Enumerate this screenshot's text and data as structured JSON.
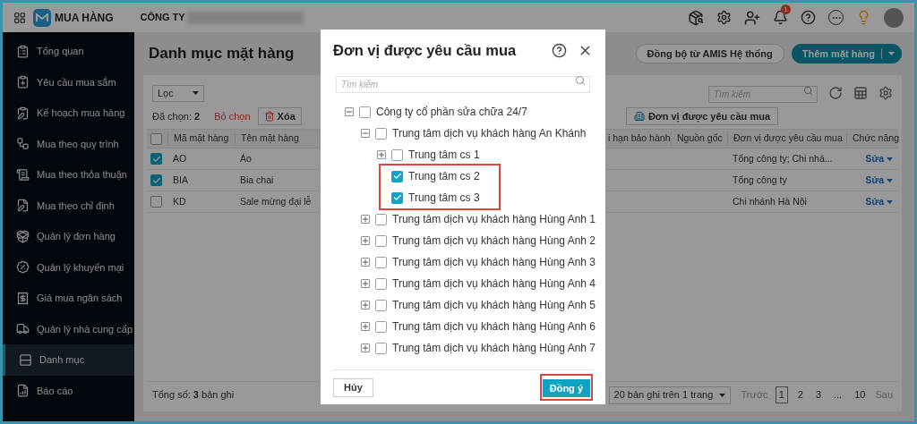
{
  "topbar": {
    "app_name": "MUA HÀNG",
    "company": "CÔNG TY",
    "notification_count": "1"
  },
  "sidebar": {
    "items": [
      {
        "label": "Tổng quan",
        "selected": false
      },
      {
        "label": "Yêu cầu mua sắm",
        "selected": false
      },
      {
        "label": "Kế hoạch mua hàng",
        "selected": false
      },
      {
        "label": "Mua theo quy trình",
        "selected": false
      },
      {
        "label": "Mua theo thỏa thuận",
        "selected": false
      },
      {
        "label": "Mua theo chỉ định",
        "selected": false
      },
      {
        "label": "Quản lý đơn hàng",
        "selected": false
      },
      {
        "label": "Quản lý khuyến mại",
        "selected": false
      },
      {
        "label": "Giá mua ngân sách",
        "selected": false
      },
      {
        "label": "Quản lý nhà cung cấp",
        "selected": false
      },
      {
        "label": "Danh mục",
        "selected": true
      },
      {
        "label": "Báo cáo",
        "selected": false
      }
    ]
  },
  "page": {
    "title": "Danh mục mặt hàng",
    "sync_button": "Đồng bộ từ AMIS Hệ thống",
    "add_button": "Thêm mặt hàng",
    "filter": "Lọc",
    "selected_count": "Đã chọn: **2**",
    "deselect": "Bỏ chọn",
    "delete_button": "Xóa",
    "unit_button": "Đơn vị được yêu cầu mua",
    "search_placeholder": "Tìm kiếm"
  },
  "table": {
    "all_checked": false,
    "columns": [
      "Mã mặt hàng",
      "Tên mặt hàng",
      "i hạn bảo hành",
      "Nguồn gốc",
      "Đơn vị được yêu cầu mua",
      "Chức năng"
    ],
    "rows": [
      {
        "checked": true,
        "code": "AO",
        "name": "Áo",
        "unit": "Tổng công ty; Chi nhá...",
        "action": "Sửa"
      },
      {
        "checked": true,
        "code": "BIA",
        "name": "Bia chai",
        "unit": "Tổng công ty",
        "action": "Sửa"
      },
      {
        "checked": false,
        "code": "KD",
        "name": "Sale mừng đại lễ",
        "unit": "Chi nhánh Hà Nội",
        "action": "Sửa"
      }
    ]
  },
  "footer": {
    "total": "Tổng số: **3** bản ghi",
    "page_size": "20 bản ghi trên 1 trang",
    "prev": "Trước",
    "pages": [
      {
        "label": "1",
        "selected": true
      },
      {
        "label": "2",
        "selected": false
      },
      {
        "label": "3",
        "selected": false
      },
      {
        "label": "...",
        "selected": false
      },
      {
        "label": "10",
        "selected": false
      }
    ],
    "next": "Sau"
  },
  "modal": {
    "title": "Đơn vị được yêu cầu mua",
    "search_placeholder": "Tìm kiếm",
    "tree": [
      {
        "kind": "branch",
        "label": "Công ty cổ phần sửa chữa 24/7",
        "expanded": true,
        "checked": false,
        "children": [
          {
            "kind": "branch",
            "label": "Trung tâm dịch vụ khách hàng An Khánh",
            "expanded": true,
            "checked": false,
            "children": [
              {
                "kind": "branch",
                "label": "Trung tâm cs 1",
                "expanded": false,
                "checked": false
              },
              {
                "kind": "leaf",
                "label": "Trung tâm cs 2",
                "checked": true,
                "highlighted": true
              },
              {
                "kind": "leaf",
                "label": "Trung tâm cs 3",
                "checked": true,
                "highlighted": true
              }
            ]
          },
          {
            "kind": "branch",
            "label": "Trung tâm dịch vụ khách hàng Hùng Anh 1",
            "expanded": false,
            "checked": false
          },
          {
            "kind": "branch",
            "label": "Trung tâm dịch vụ khách hàng Hùng Anh 2",
            "expanded": false,
            "checked": false
          },
          {
            "kind": "branch",
            "label": "Trung tâm dịch vụ khách hàng Hùng Anh 3",
            "expanded": false,
            "checked": false
          },
          {
            "kind": "branch",
            "label": "Trung tâm dịch vụ khách hàng Hùng Anh 4",
            "expanded": false,
            "checked": false
          },
          {
            "kind": "branch",
            "label": "Trung tâm dịch vụ khách hàng Hùng Anh 5",
            "expanded": false,
            "checked": false
          },
          {
            "kind": "branch",
            "label": "Trung tâm dịch vụ khách hàng Hùng Anh 6",
            "expanded": false,
            "checked": false
          },
          {
            "kind": "branch",
            "label": "Trung tâm dịch vụ khách hàng Hùng Anh 7",
            "expanded": false,
            "checked": false
          }
        ]
      }
    ],
    "cancel_button": "Hủy",
    "confirm_button": "Đồng ý",
    "confirm_highlighted": true
  }
}
